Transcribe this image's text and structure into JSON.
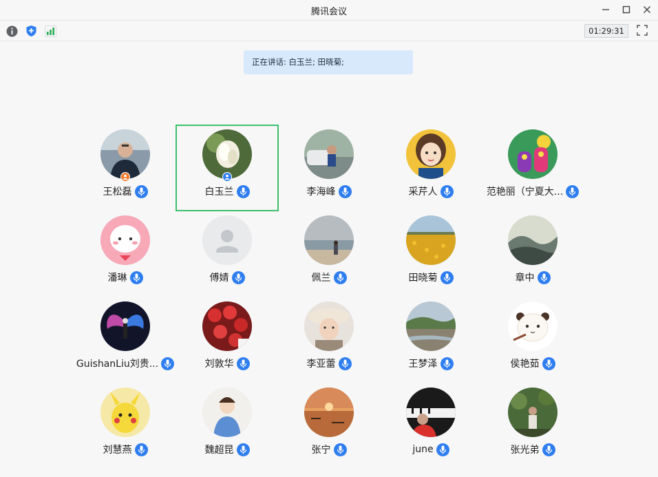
{
  "window": {
    "title": "腾讯会议"
  },
  "toolbar": {
    "timer": "01:29:31"
  },
  "speaking": {
    "text": "正在讲话: 白玉兰; 田晓菊;"
  },
  "colors": {
    "accent": "#2f7ef0",
    "active_border": "#3dbf6a",
    "speaking_bg": "#d9e9fc"
  },
  "participants": [
    {
      "name": "王松磊",
      "avatar": "man-in-car",
      "badge": "host"
    },
    {
      "name": "白玉兰",
      "avatar": "white-magnolia",
      "badge": "cohost",
      "active": true
    },
    {
      "name": "李海峰",
      "avatar": "child-by-car"
    },
    {
      "name": "采芹人",
      "avatar": "cartoon-girl"
    },
    {
      "name": "范艳丽（宁夏大...",
      "avatar": "colorful-cartoon"
    },
    {
      "name": "潘琳",
      "avatar": "pink-cartoon"
    },
    {
      "name": "傅婧",
      "avatar": "default-person"
    },
    {
      "name": "佩兰",
      "avatar": "person-on-beach"
    },
    {
      "name": "田晓菊",
      "avatar": "flower-field"
    },
    {
      "name": "章中",
      "avatar": "ink-landscape"
    },
    {
      "name": "GuishanLiu刘贵...",
      "avatar": "person-with-wings"
    },
    {
      "name": "刘敦华",
      "avatar": "red-fruits"
    },
    {
      "name": "李亚蕾",
      "avatar": "woman-in-hat"
    },
    {
      "name": "王梦泽",
      "avatar": "riverbank"
    },
    {
      "name": "侯艳茹",
      "avatar": "bear-cartoon"
    },
    {
      "name": "刘慧燕",
      "avatar": "pikachu"
    },
    {
      "name": "魏超昆",
      "avatar": "illustrated-boy"
    },
    {
      "name": "张宁",
      "avatar": "sunset-lake"
    },
    {
      "name": "june",
      "avatar": "piano-child"
    },
    {
      "name": "张光弟",
      "avatar": "man-in-garden"
    }
  ]
}
